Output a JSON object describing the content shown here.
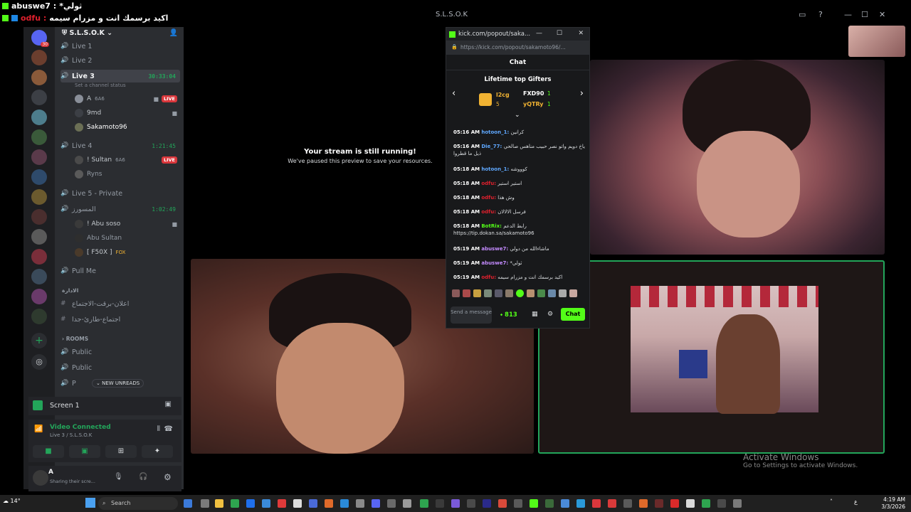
{
  "overlay": {
    "line1_name": "abuswe7 :",
    "line1_text": "*ثولي",
    "line2_name": "odfu :",
    "line2_text": "اكيد برسمك انت و مزرام سيمه"
  },
  "window": {
    "title": "S.L.S.O.K",
    "min": "—",
    "max": "☐",
    "close": "✕"
  },
  "server": {
    "name": "S.L.S.O.K",
    "badge": "30"
  },
  "channels": {
    "live1": "Live 1",
    "live2": "Live 2",
    "live3": "Live 3",
    "live3_time": "30:33:04",
    "live3_status": "Set a channel status",
    "live3_users": [
      "A",
      "9md",
      "Sakamoto96"
    ],
    "live3_user1_tag": "6A6",
    "live4": "Live 4",
    "live4_time": "1:21:45",
    "live4_users": [
      "! Sultan",
      "Ryns"
    ],
    "live4_user1_tag": "6A6",
    "live5": "Live 5 - Private",
    "arabic_vc": "المسورز",
    "arabic_vc_time": "1:02:49",
    "arabic_vc_users": [
      "! Abu soso",
      "Abu Sultan",
      "[ F50X ]"
    ],
    "arabic_vc_user3_tag": "FOX",
    "pull_me": "Pull Me",
    "cat_admin": "الادارة",
    "admin_ch1": "اعلان-برقت-الاجتماع",
    "admin_ch2": "اجتماع-طارئ-جدا",
    "cat_rooms": "ROOMS",
    "rooms": [
      "Public",
      "Public",
      "P"
    ],
    "new_unreads": "NEW UNREADS",
    "live_label": "LIVE"
  },
  "screen_bar": {
    "label": "Screen 1"
  },
  "voice": {
    "status": "Video Connected",
    "channel": "Live 3 / S.L.S.O.K"
  },
  "user_panel": {
    "name": "A",
    "status": "Sharing their scre..."
  },
  "stage": {
    "paused_title": "Your stream is still running!",
    "paused_sub": "We've paused this preview to save your resources."
  },
  "kick": {
    "tab_title": "kick.com/popout/saka...",
    "url": "https://kick.com/popout/sakamoto96/...",
    "chat_title": "Chat",
    "gifters_title": "Lifetime top Gifters",
    "gifters": [
      {
        "name": "l2cg",
        "count": "5"
      },
      {
        "name": "FXD90",
        "count": "1"
      },
      {
        "name": "yQTRy",
        "count": "1"
      }
    ],
    "messages": [
      {
        "time": "05:16 AM",
        "user": "hotoon_1:",
        "color": "#5fa8ff",
        "text": "كرانين"
      },
      {
        "time": "05:16 AM",
        "user": "Die_77:",
        "color": "#5fa8ff",
        "text": "ياخ دويم واتو نصر حبيب مناهس صالحي ذيل ما قطروا"
      },
      {
        "time": "05:18 AM",
        "user": "hotoon_1:",
        "color": "#5fa8ff",
        "text": "كوووشه"
      },
      {
        "time": "05:18 AM",
        "user": "odfu:",
        "color": "#e0202d",
        "text": "استير استير"
      },
      {
        "time": "05:18 AM",
        "user": "odfu:",
        "color": "#e0202d",
        "text": "وش هذا"
      },
      {
        "time": "05:18 AM",
        "user": "odfu:",
        "color": "#e0202d",
        "text": "فرسل الالالان"
      },
      {
        "time": "05:18 AM",
        "user": "BotRix:",
        "color": "#53fc18",
        "text": "رابط الدعم https://tip.dokan.sa/sakamoto96"
      },
      {
        "time": "05:19 AM",
        "user": "abuswe7:",
        "color": "#c48bff",
        "text": "ماشاءالله من دولي"
      },
      {
        "time": "05:19 AM",
        "user": "abuswe7:",
        "color": "#c48bff",
        "text": "*ثولي"
      },
      {
        "time": "05:19 AM",
        "user": "odfu:",
        "color": "#e0202d",
        "text": "اكيد برسمك انت و مزرام سيمه"
      }
    ],
    "send_placeholder": "Send a message",
    "points": "813",
    "chat_button": "Chat"
  },
  "watermark": {
    "title": "Activate Windows",
    "sub": "Go to Settings to activate Windows."
  },
  "taskbar": {
    "weather": "14°",
    "search": "Search",
    "time": "4:19 AM",
    "date": "3/3/2026",
    "lang": "ع"
  }
}
